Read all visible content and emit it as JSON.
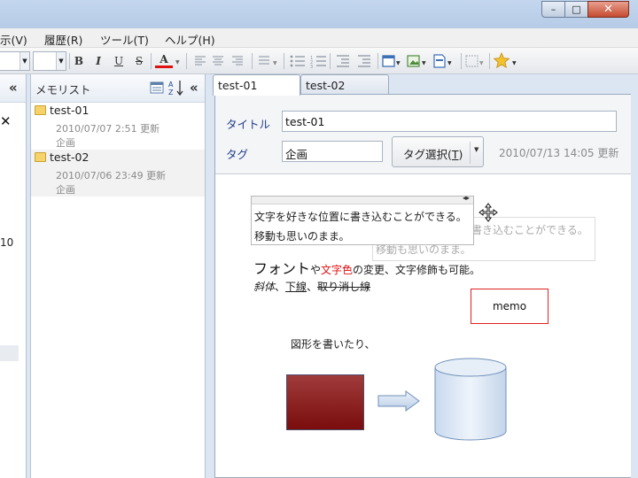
{
  "menu": {
    "items": [
      "示(V)",
      "履歴(R)",
      "ツール(T)",
      "ヘルプ(H)"
    ]
  },
  "window_buttons": {
    "minimize": "–",
    "maximize": "□",
    "close": "✕"
  },
  "toolbar": {
    "bold": "B",
    "italic": "I",
    "underline": "U",
    "strikethrough": "S",
    "font_color": "A",
    "font_color_accent": "#e01010"
  },
  "left_pane": {
    "collapse_glyph": "«",
    "close_glyph": "✕",
    "partial_value": "10"
  },
  "memo_list": {
    "title": "メモリスト",
    "collapse_glyph": "«",
    "items": [
      {
        "title": "test-01",
        "updated": "2010/07/07 2:51 更新",
        "tag": "企画"
      },
      {
        "title": "test-02",
        "updated": "2010/07/06 23:49 更新",
        "tag": "企画"
      }
    ]
  },
  "tabs": [
    {
      "label": "test-01"
    },
    {
      "label": "test-02"
    }
  ],
  "properties": {
    "title_label": "タイトル",
    "title_value": "test-01",
    "tag_label": "タグ",
    "tag_value": "企画",
    "tag_select_label": "タグ選択(",
    "tag_select_key": "T",
    "tag_select_close": ")",
    "timestamp": "2010/07/13 14:05 更新"
  },
  "canvas": {
    "textbox_line1": "文字を好きな位置に書き込むことができる。",
    "textbox_line2": "移動も思いのまま。",
    "ghost_line1": "文字を好きな位置に書き込むことができる。",
    "ghost_line2": "移動も思いのまま。",
    "font_big": "フォント",
    "font_ya": "や",
    "font_red": "文字色",
    "font_rest": "の変更、文字修飾も可能。",
    "italic_text": "斜体",
    "sep1": "、",
    "underline_text": "下線",
    "sep2": "、",
    "strike_text": "取り消し線",
    "memo_box": "memo",
    "shape_text": "図形を書いたり、"
  }
}
